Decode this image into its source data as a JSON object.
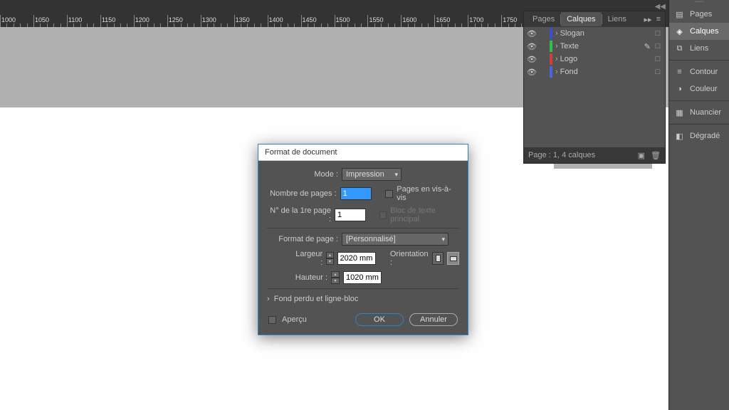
{
  "ruler": {
    "start": 1000,
    "end": 1950,
    "step_major": 50
  },
  "panel": {
    "tabs": [
      "Pages",
      "Calques",
      "Liens"
    ],
    "active_tab": 1,
    "layers": [
      {
        "name": "Slogan",
        "color": "#3a4fd8",
        "editable": false
      },
      {
        "name": "Texte",
        "color": "#29c441",
        "editable": true
      },
      {
        "name": "Logo",
        "color": "#d83a3a",
        "editable": false
      },
      {
        "name": "Fond",
        "color": "#4a62e6",
        "editable": false
      }
    ],
    "footer": "Page : 1, 4 calques"
  },
  "sidebar": {
    "groups": [
      [
        {
          "id": "pages",
          "label": "Pages"
        },
        {
          "id": "calques",
          "label": "Calques"
        },
        {
          "id": "liens",
          "label": "Liens"
        }
      ],
      [
        {
          "id": "contour",
          "label": "Contour"
        },
        {
          "id": "couleur",
          "label": "Couleur"
        }
      ],
      [
        {
          "id": "nuancier",
          "label": "Nuancier"
        }
      ],
      [
        {
          "id": "degrade",
          "label": "Dégradé"
        }
      ]
    ],
    "active": "calques"
  },
  "dialog": {
    "title": "Format de document",
    "mode_label": "Mode :",
    "mode_value": "Impression",
    "npages_label": "Nombre de pages :",
    "npages_value": "1",
    "facing_label": "Pages en vis-à-vis",
    "firstpage_label": "N° de la 1re page :",
    "firstpage_value": "1",
    "primarytext_label": "Bloc de texte principal",
    "pageformat_label": "Format de page :",
    "pageformat_value": "[Personnalisé]",
    "width_label": "Largeur :",
    "width_value": "2020 mm",
    "height_label": "Hauteur :",
    "height_value": "1020 mm",
    "orientation_label": "Orientation :",
    "disclosure": "Fond perdu et ligne-bloc",
    "preview_label": "Aperçu",
    "ok": "OK",
    "cancel": "Annuler"
  }
}
